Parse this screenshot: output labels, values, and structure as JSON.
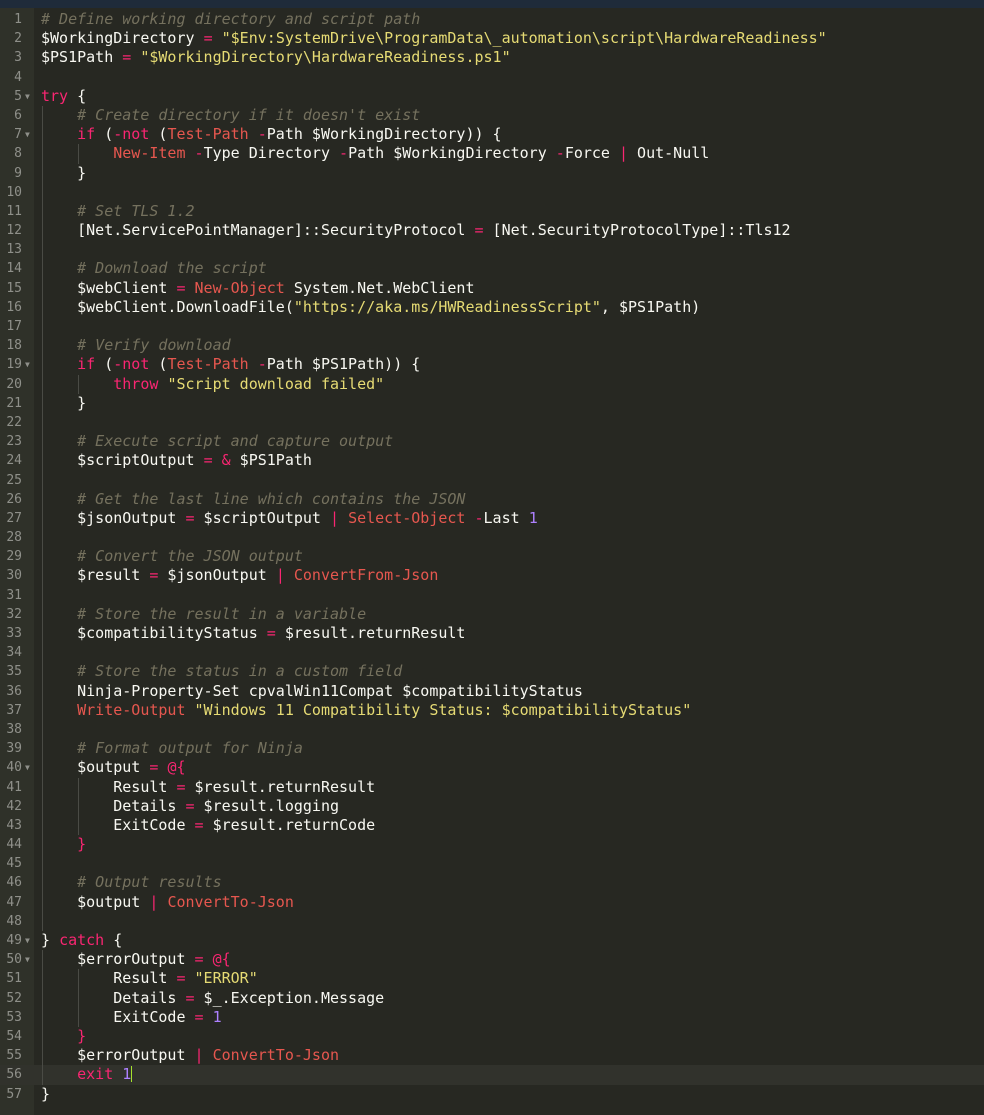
{
  "theme": {
    "background": "#272822",
    "gutter": "#2f3129",
    "comment": "#75715e",
    "string": "#e6db74",
    "keyword": "#f92672",
    "cmdlet": "#e6574f",
    "variable": "#f8f8f2",
    "number": "#ae81ff",
    "text": "#f8f8f2",
    "operator": "#f92672",
    "cursor": "#a6e22e"
  },
  "editor": {
    "language": "powershell",
    "cursor_line": 56,
    "lines": [
      {
        "n": 1,
        "fold": false,
        "indent": 0,
        "tokens": [
          [
            "c",
            "# Define working directory and script path"
          ]
        ]
      },
      {
        "n": 2,
        "fold": false,
        "indent": 0,
        "tokens": [
          [
            "v",
            "$WorkingDirectory"
          ],
          [
            "t",
            " "
          ],
          [
            "o",
            "="
          ],
          [
            "t",
            " "
          ],
          [
            "s",
            "\"$Env:"
          ],
          [
            "d",
            "SystemDrive\\ProgramData\\_automation\\script\\HardwareReadiness"
          ],
          [
            "s",
            "\""
          ]
        ]
      },
      {
        "n": 3,
        "fold": false,
        "indent": 0,
        "tokens": [
          [
            "v",
            "$PS1Path"
          ],
          [
            "t",
            " "
          ],
          [
            "o",
            "="
          ],
          [
            "t",
            " "
          ],
          [
            "s",
            "\"$WorkingDirectory"
          ],
          [
            "d",
            "\\HardwareReadiness.ps1"
          ],
          [
            "s",
            "\""
          ]
        ]
      },
      {
        "n": 4,
        "fold": false,
        "indent": 0,
        "tokens": []
      },
      {
        "n": 5,
        "fold": true,
        "indent": 0,
        "tokens": [
          [
            "k",
            "try"
          ],
          [
            "t",
            " {"
          ]
        ]
      },
      {
        "n": 6,
        "fold": false,
        "indent": 1,
        "tokens": [
          [
            "t",
            "    "
          ],
          [
            "c",
            "# Create directory if it doesn't exist"
          ]
        ]
      },
      {
        "n": 7,
        "fold": true,
        "indent": 1,
        "tokens": [
          [
            "t",
            "    "
          ],
          [
            "k",
            "if"
          ],
          [
            "t",
            " ("
          ],
          [
            "k",
            "-not"
          ],
          [
            "t",
            " ("
          ],
          [
            "m",
            "Test-Path"
          ],
          [
            "t",
            " "
          ],
          [
            "o",
            "-"
          ],
          [
            "t",
            "Path $WorkingDirectory)) {"
          ]
        ]
      },
      {
        "n": 8,
        "fold": false,
        "indent": 2,
        "tokens": [
          [
            "t",
            "        "
          ],
          [
            "m",
            "New-Item"
          ],
          [
            "t",
            " "
          ],
          [
            "o",
            "-"
          ],
          [
            "t",
            "Type Directory "
          ],
          [
            "o",
            "-"
          ],
          [
            "t",
            "Path $WorkingDirectory "
          ],
          [
            "o",
            "-"
          ],
          [
            "t",
            "Force "
          ],
          [
            "o",
            "|"
          ],
          [
            "t",
            " Out-Null"
          ]
        ]
      },
      {
        "n": 9,
        "fold": false,
        "indent": 1,
        "tokens": [
          [
            "t",
            "    }"
          ]
        ]
      },
      {
        "n": 10,
        "fold": false,
        "indent": 1,
        "tokens": []
      },
      {
        "n": 11,
        "fold": false,
        "indent": 1,
        "tokens": [
          [
            "t",
            "    "
          ],
          [
            "c",
            "# Set TLS 1.2"
          ]
        ]
      },
      {
        "n": 12,
        "fold": false,
        "indent": 1,
        "tokens": [
          [
            "t",
            "    [Net.ServicePointManager]::SecurityProtocol "
          ],
          [
            "o",
            "="
          ],
          [
            "t",
            " [Net.SecurityProtocolType]::Tls12"
          ]
        ]
      },
      {
        "n": 13,
        "fold": false,
        "indent": 1,
        "tokens": []
      },
      {
        "n": 14,
        "fold": false,
        "indent": 1,
        "tokens": [
          [
            "t",
            "    "
          ],
          [
            "c",
            "# Download the script"
          ]
        ]
      },
      {
        "n": 15,
        "fold": false,
        "indent": 1,
        "tokens": [
          [
            "t",
            "    $webClient "
          ],
          [
            "o",
            "="
          ],
          [
            "t",
            " "
          ],
          [
            "m",
            "New-Object"
          ],
          [
            "t",
            " System.Net.WebClient"
          ]
        ]
      },
      {
        "n": 16,
        "fold": false,
        "indent": 1,
        "tokens": [
          [
            "t",
            "    $webClient.DownloadFile("
          ],
          [
            "s",
            "\"https://aka.ms/HWReadinessScript\""
          ],
          [
            "t",
            ", $PS1Path)"
          ]
        ]
      },
      {
        "n": 17,
        "fold": false,
        "indent": 1,
        "tokens": []
      },
      {
        "n": 18,
        "fold": false,
        "indent": 1,
        "tokens": [
          [
            "t",
            "    "
          ],
          [
            "c",
            "# Verify download"
          ]
        ]
      },
      {
        "n": 19,
        "fold": true,
        "indent": 1,
        "tokens": [
          [
            "t",
            "    "
          ],
          [
            "k",
            "if"
          ],
          [
            "t",
            " ("
          ],
          [
            "k",
            "-not"
          ],
          [
            "t",
            " ("
          ],
          [
            "m",
            "Test-Path"
          ],
          [
            "t",
            " "
          ],
          [
            "o",
            "-"
          ],
          [
            "t",
            "Path $PS1Path)) {"
          ]
        ]
      },
      {
        "n": 20,
        "fold": false,
        "indent": 2,
        "tokens": [
          [
            "t",
            "        "
          ],
          [
            "k",
            "throw"
          ],
          [
            "t",
            " "
          ],
          [
            "s",
            "\"Script download failed\""
          ]
        ]
      },
      {
        "n": 21,
        "fold": false,
        "indent": 1,
        "tokens": [
          [
            "t",
            "    }"
          ]
        ]
      },
      {
        "n": 22,
        "fold": false,
        "indent": 1,
        "tokens": []
      },
      {
        "n": 23,
        "fold": false,
        "indent": 1,
        "tokens": [
          [
            "t",
            "    "
          ],
          [
            "c",
            "# Execute script and capture output"
          ]
        ]
      },
      {
        "n": 24,
        "fold": false,
        "indent": 1,
        "tokens": [
          [
            "t",
            "    $scriptOutput "
          ],
          [
            "o",
            "="
          ],
          [
            "t",
            " "
          ],
          [
            "o",
            "&"
          ],
          [
            "t",
            " $PS1Path"
          ]
        ]
      },
      {
        "n": 25,
        "fold": false,
        "indent": 1,
        "tokens": []
      },
      {
        "n": 26,
        "fold": false,
        "indent": 1,
        "tokens": [
          [
            "t",
            "    "
          ],
          [
            "c",
            "# Get the last line which contains the JSON"
          ]
        ]
      },
      {
        "n": 27,
        "fold": false,
        "indent": 1,
        "tokens": [
          [
            "t",
            "    $jsonOutput "
          ],
          [
            "o",
            "="
          ],
          [
            "t",
            " $scriptOutput "
          ],
          [
            "o",
            "|"
          ],
          [
            "t",
            " "
          ],
          [
            "m",
            "Select-Object"
          ],
          [
            "t",
            " "
          ],
          [
            "o",
            "-"
          ],
          [
            "t",
            "Last "
          ],
          [
            "n",
            "1"
          ]
        ]
      },
      {
        "n": 28,
        "fold": false,
        "indent": 1,
        "tokens": []
      },
      {
        "n": 29,
        "fold": false,
        "indent": 1,
        "tokens": [
          [
            "t",
            "    "
          ],
          [
            "c",
            "# Convert the JSON output"
          ]
        ]
      },
      {
        "n": 30,
        "fold": false,
        "indent": 1,
        "tokens": [
          [
            "t",
            "    $result "
          ],
          [
            "o",
            "="
          ],
          [
            "t",
            " $jsonOutput "
          ],
          [
            "o",
            "|"
          ],
          [
            "t",
            " "
          ],
          [
            "m",
            "ConvertFrom-Json"
          ]
        ]
      },
      {
        "n": 31,
        "fold": false,
        "indent": 1,
        "tokens": []
      },
      {
        "n": 32,
        "fold": false,
        "indent": 1,
        "tokens": [
          [
            "t",
            "    "
          ],
          [
            "c",
            "# Store the result in a variable"
          ]
        ]
      },
      {
        "n": 33,
        "fold": false,
        "indent": 1,
        "tokens": [
          [
            "t",
            "    $compatibilityStatus "
          ],
          [
            "o",
            "="
          ],
          [
            "t",
            " $result.returnResult"
          ]
        ]
      },
      {
        "n": 34,
        "fold": false,
        "indent": 1,
        "tokens": []
      },
      {
        "n": 35,
        "fold": false,
        "indent": 1,
        "tokens": [
          [
            "t",
            "    "
          ],
          [
            "c",
            "# Store the status in a custom field"
          ]
        ]
      },
      {
        "n": 36,
        "fold": false,
        "indent": 1,
        "tokens": [
          [
            "t",
            "    Ninja-Property-Set cpvalWin11Compat $compatibilityStatus"
          ]
        ]
      },
      {
        "n": 37,
        "fold": false,
        "indent": 1,
        "tokens": [
          [
            "t",
            "    "
          ],
          [
            "m",
            "Write-Output"
          ],
          [
            "t",
            " "
          ],
          [
            "s",
            "\"Windows 11 Compatibility Status: $compatibilityStatus\""
          ]
        ]
      },
      {
        "n": 38,
        "fold": false,
        "indent": 1,
        "tokens": []
      },
      {
        "n": 39,
        "fold": false,
        "indent": 1,
        "tokens": [
          [
            "t",
            "    "
          ],
          [
            "c",
            "# Format output for Ninja"
          ]
        ]
      },
      {
        "n": 40,
        "fold": true,
        "indent": 1,
        "tokens": [
          [
            "t",
            "    $output "
          ],
          [
            "o",
            "="
          ],
          [
            "t",
            " "
          ],
          [
            "o",
            "@{"
          ]
        ]
      },
      {
        "n": 41,
        "fold": false,
        "indent": 2,
        "tokens": [
          [
            "t",
            "        Result "
          ],
          [
            "o",
            "="
          ],
          [
            "t",
            " $result.returnResult"
          ]
        ]
      },
      {
        "n": 42,
        "fold": false,
        "indent": 2,
        "tokens": [
          [
            "t",
            "        Details "
          ],
          [
            "o",
            "="
          ],
          [
            "t",
            " $result.logging"
          ]
        ]
      },
      {
        "n": 43,
        "fold": false,
        "indent": 2,
        "tokens": [
          [
            "t",
            "        ExitCode "
          ],
          [
            "o",
            "="
          ],
          [
            "t",
            " $result.returnCode"
          ]
        ]
      },
      {
        "n": 44,
        "fold": false,
        "indent": 1,
        "tokens": [
          [
            "t",
            "    "
          ],
          [
            "o",
            "}"
          ]
        ]
      },
      {
        "n": 45,
        "fold": false,
        "indent": 1,
        "tokens": []
      },
      {
        "n": 46,
        "fold": false,
        "indent": 1,
        "tokens": [
          [
            "t",
            "    "
          ],
          [
            "c",
            "# Output results"
          ]
        ]
      },
      {
        "n": 47,
        "fold": false,
        "indent": 1,
        "tokens": [
          [
            "t",
            "    $output "
          ],
          [
            "o",
            "|"
          ],
          [
            "t",
            " "
          ],
          [
            "m",
            "ConvertTo-Json"
          ]
        ]
      },
      {
        "n": 48,
        "fold": false,
        "indent": 1,
        "tokens": []
      },
      {
        "n": 49,
        "fold": true,
        "indent": 0,
        "tokens": [
          [
            "t",
            "} "
          ],
          [
            "k",
            "catch"
          ],
          [
            "t",
            " {"
          ]
        ]
      },
      {
        "n": 50,
        "fold": true,
        "indent": 1,
        "tokens": [
          [
            "t",
            "    $errorOutput "
          ],
          [
            "o",
            "="
          ],
          [
            "t",
            " "
          ],
          [
            "o",
            "@{"
          ]
        ]
      },
      {
        "n": 51,
        "fold": false,
        "indent": 2,
        "tokens": [
          [
            "t",
            "        Result "
          ],
          [
            "o",
            "="
          ],
          [
            "t",
            " "
          ],
          [
            "s",
            "\"ERROR\""
          ]
        ]
      },
      {
        "n": 52,
        "fold": false,
        "indent": 2,
        "tokens": [
          [
            "t",
            "        Details "
          ],
          [
            "o",
            "="
          ],
          [
            "t",
            " $_.Exception.Message"
          ]
        ]
      },
      {
        "n": 53,
        "fold": false,
        "indent": 2,
        "tokens": [
          [
            "t",
            "        ExitCode "
          ],
          [
            "o",
            "="
          ],
          [
            "t",
            " "
          ],
          [
            "n",
            "1"
          ]
        ]
      },
      {
        "n": 54,
        "fold": false,
        "indent": 1,
        "tokens": [
          [
            "t",
            "    "
          ],
          [
            "o",
            "}"
          ]
        ]
      },
      {
        "n": 55,
        "fold": false,
        "indent": 1,
        "tokens": [
          [
            "t",
            "    $errorOutput "
          ],
          [
            "o",
            "|"
          ],
          [
            "t",
            " "
          ],
          [
            "m",
            "ConvertTo-Json"
          ]
        ]
      },
      {
        "n": 56,
        "fold": false,
        "indent": 1,
        "tokens": [
          [
            "t",
            "    "
          ],
          [
            "k",
            "exit"
          ],
          [
            "t",
            " "
          ],
          [
            "n",
            "1"
          ]
        ]
      },
      {
        "n": 57,
        "fold": false,
        "indent": 0,
        "tokens": [
          [
            "t",
            "}"
          ]
        ]
      }
    ]
  }
}
